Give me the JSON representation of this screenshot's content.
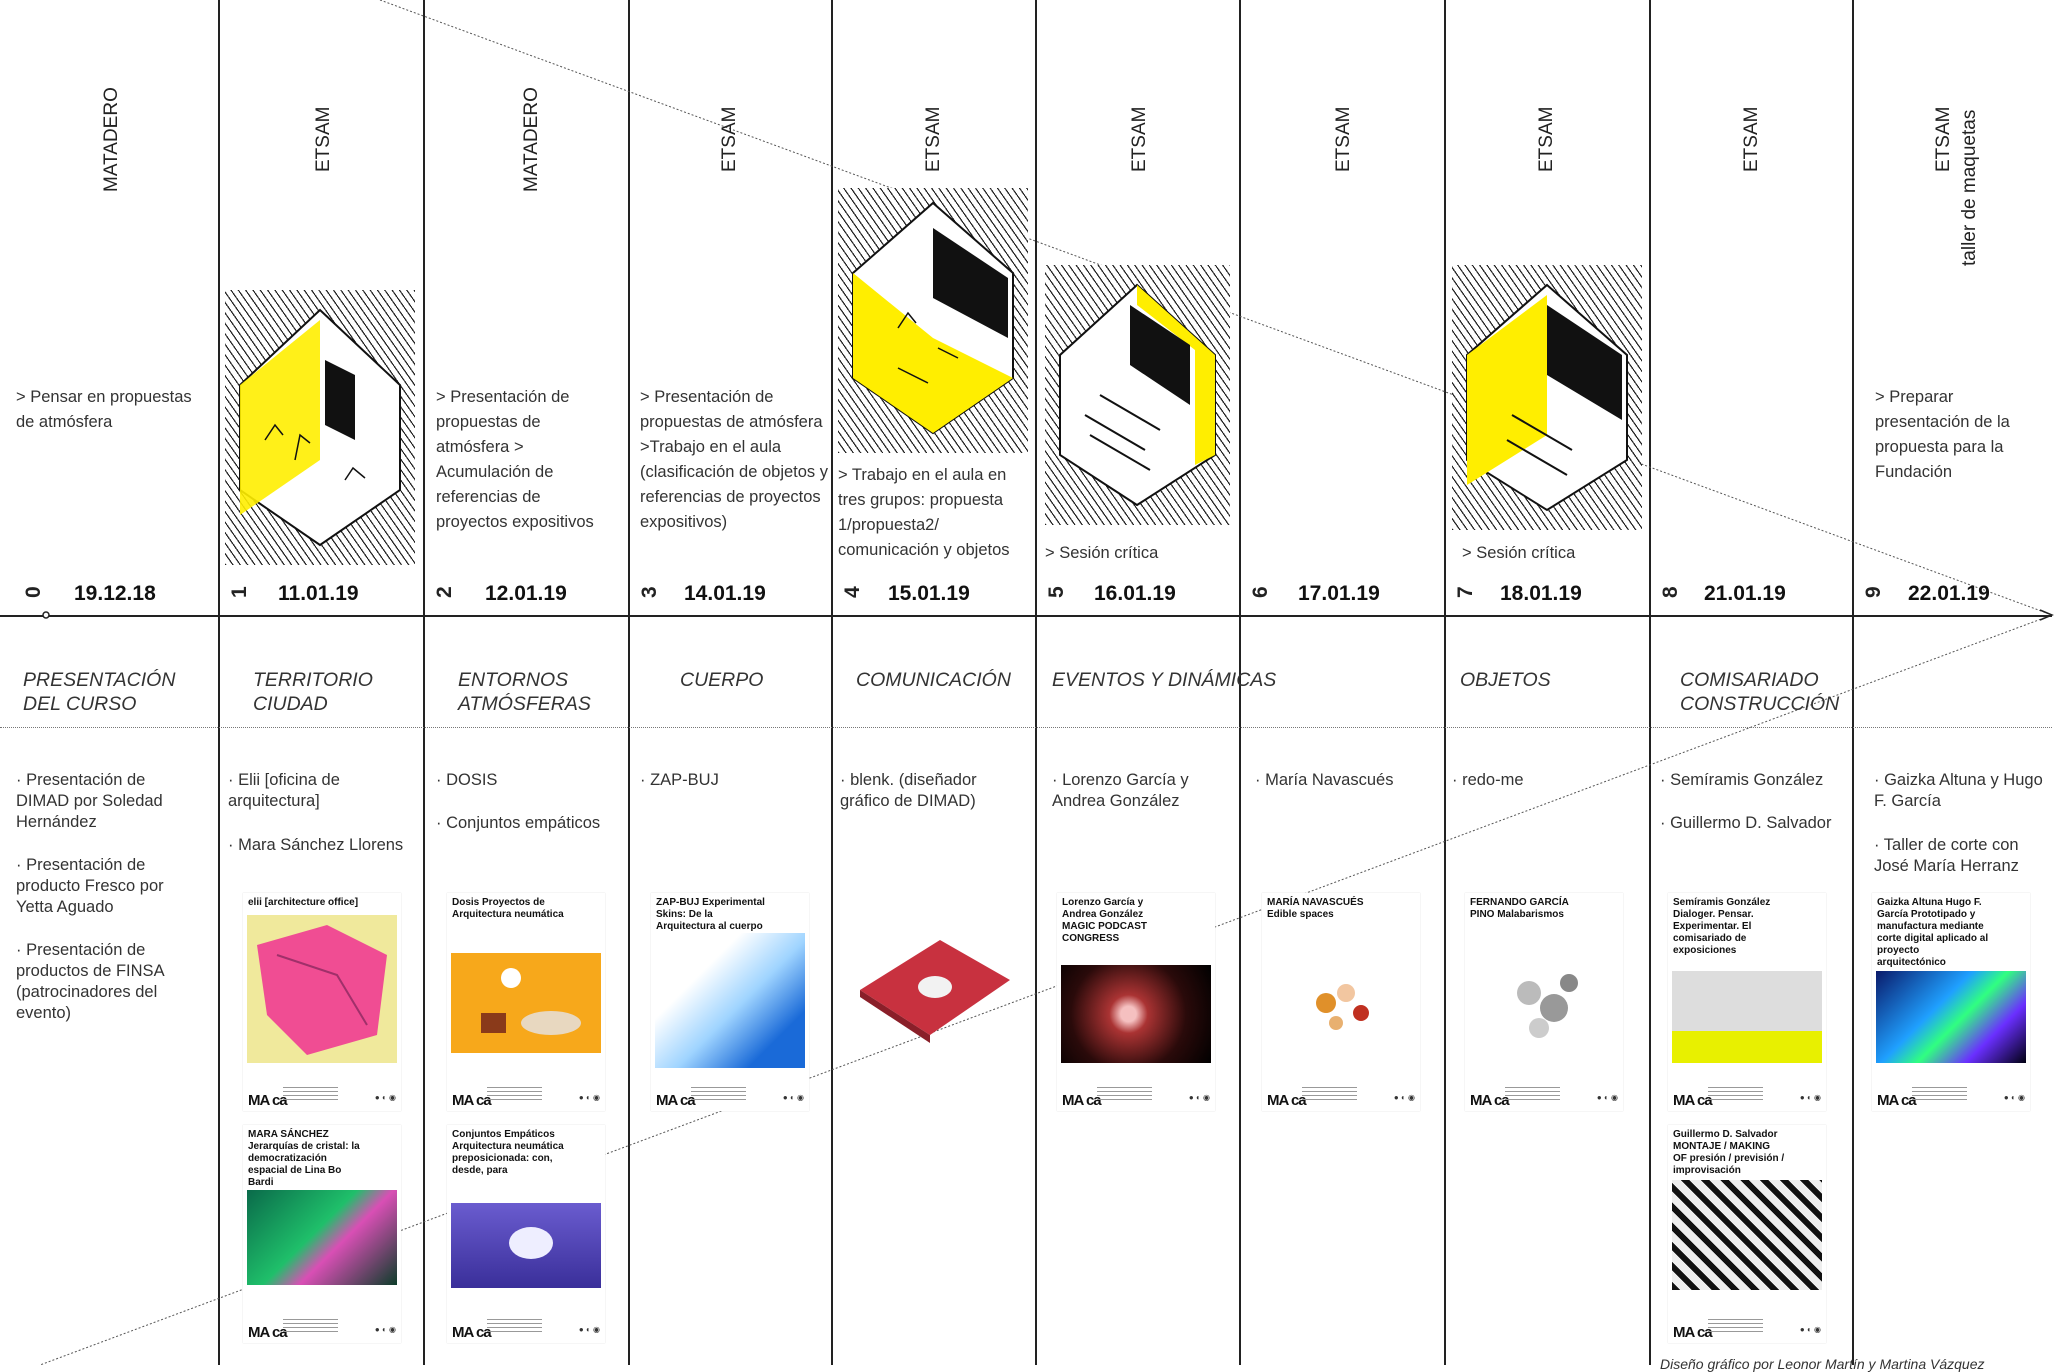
{
  "locations": [
    "MATADERO",
    "ETSAM",
    "MATADERO",
    "ETSAM",
    "ETSAM",
    "ETSAM",
    "ETSAM",
    "ETSAM",
    "ETSAM",
    "ETSAM",
    "taller de maquetas"
  ],
  "sessions": [
    {
      "num": "0",
      "date": "19.12.18"
    },
    {
      "num": "1",
      "date": "11.01.19"
    },
    {
      "num": "2",
      "date": "12.01.19"
    },
    {
      "num": "3",
      "date": "14.01.19"
    },
    {
      "num": "4",
      "date": "15.01.19"
    },
    {
      "num": "5",
      "date": "16.01.19"
    },
    {
      "num": "6",
      "date": "17.01.19"
    },
    {
      "num": "7",
      "date": "18.01.19"
    },
    {
      "num": "8",
      "date": "21.01.19"
    },
    {
      "num": "9",
      "date": "22.01.19"
    }
  ],
  "activities": [
    "> Pensar en propuestas de atmósfera",
    "> Presentación de propuestas de atmósfera > Acumulación de referencias de proyectos expositivos",
    "> Presentación de propuestas de atmósfera >Trabajo en el aula (clasificación de objetos y referencias de proyectos expositivos)",
    "> Trabajo en el aula en tres grupos: propuesta 1/propuesta2/ comunicación y objetos",
    "> Sesión crítica",
    "> Sesión crítica",
    "> Preparar presentación de la propuesta para la Fundación"
  ],
  "themes": [
    "PRESENTACIÓN DEL CURSO",
    "TERRITORIO CIUDAD",
    "ENTORNOS ATMÓSFERAS",
    "CUERPO",
    "COMUNICACIÓN",
    "EVENTOS Y DINÁMICAS",
    "OBJETOS",
    "COMISARIADO CONSTRUCCIÓN"
  ],
  "guests": [
    "· Presentación de DIMAD por Soledad Hernández",
    "· Presentación de producto Fresco por Yetta Aguado",
    "· Presentación de productos de FINSA (patrocinadores del evento)",
    "· Elii [oficina de arquitectura]",
    "· Mara Sánchez Llorens",
    "· DOSIS",
    "· Conjuntos empáticos",
    "· ZAP-BUJ",
    "· blenk. (diseñador gráfico de DIMAD)",
    "· Lorenzo García y Andrea González",
    "· María Navascués",
    "· redo-me",
    "· Semíramis González",
    "· Guillermo D. Salvador",
    "· Gaizka Altuna y Hugo F. García",
    "· Taller de corte con José María Herranz"
  ],
  "posters": [
    {
      "title": "elii [architecture office]",
      "image": "pink-map"
    },
    {
      "title": "MARA SÁNCHEZ Jerarquías de cristal: la democratización espacial de Lina Bo Bardi",
      "image": "green-building"
    },
    {
      "title": "Dosis Proyectos de Arquitectura neumática",
      "image": "yellow-room"
    },
    {
      "title": "Conjuntos Empáticos Arquitectura neumática preposicionada: con, desde, para",
      "image": "purple-inflatable"
    },
    {
      "title": "ZAP-BUJ Experimental Skins: De la Arquitectura al cuerpo",
      "image": "blue-costume"
    },
    {
      "title": "",
      "image": "red-book"
    },
    {
      "title": "Lorenzo García y Andrea González MAGIC PODCAST CONGRESS",
      "image": "dark-particles"
    },
    {
      "title": "MARÍA NAVASCUÉS Edible spaces",
      "image": "edible"
    },
    {
      "title": "FERNANDO GARCÍA PINO Malabarismos",
      "image": "juggle"
    },
    {
      "title": "Semíramis González Dialoger. Pensar. Experimentar. El comisariado de exposiciones",
      "image": "gallery"
    },
    {
      "title": "Guillermo D. Salvador MONTAJE / MAKING OF presión / previsión / improvisación",
      "image": "workshop"
    },
    {
      "title": "Gaizka Altuna Hugo F. García Prototipado y manufactura mediante corte digital aplicado al proyecto arquitectónico",
      "image": "neon"
    }
  ],
  "maca_logo": "MA ca",
  "credit": "Diseño gráfico por Leonor Martín y Martina Vázquez",
  "colors": {
    "accent": "#ffee00",
    "line": "#222222"
  }
}
